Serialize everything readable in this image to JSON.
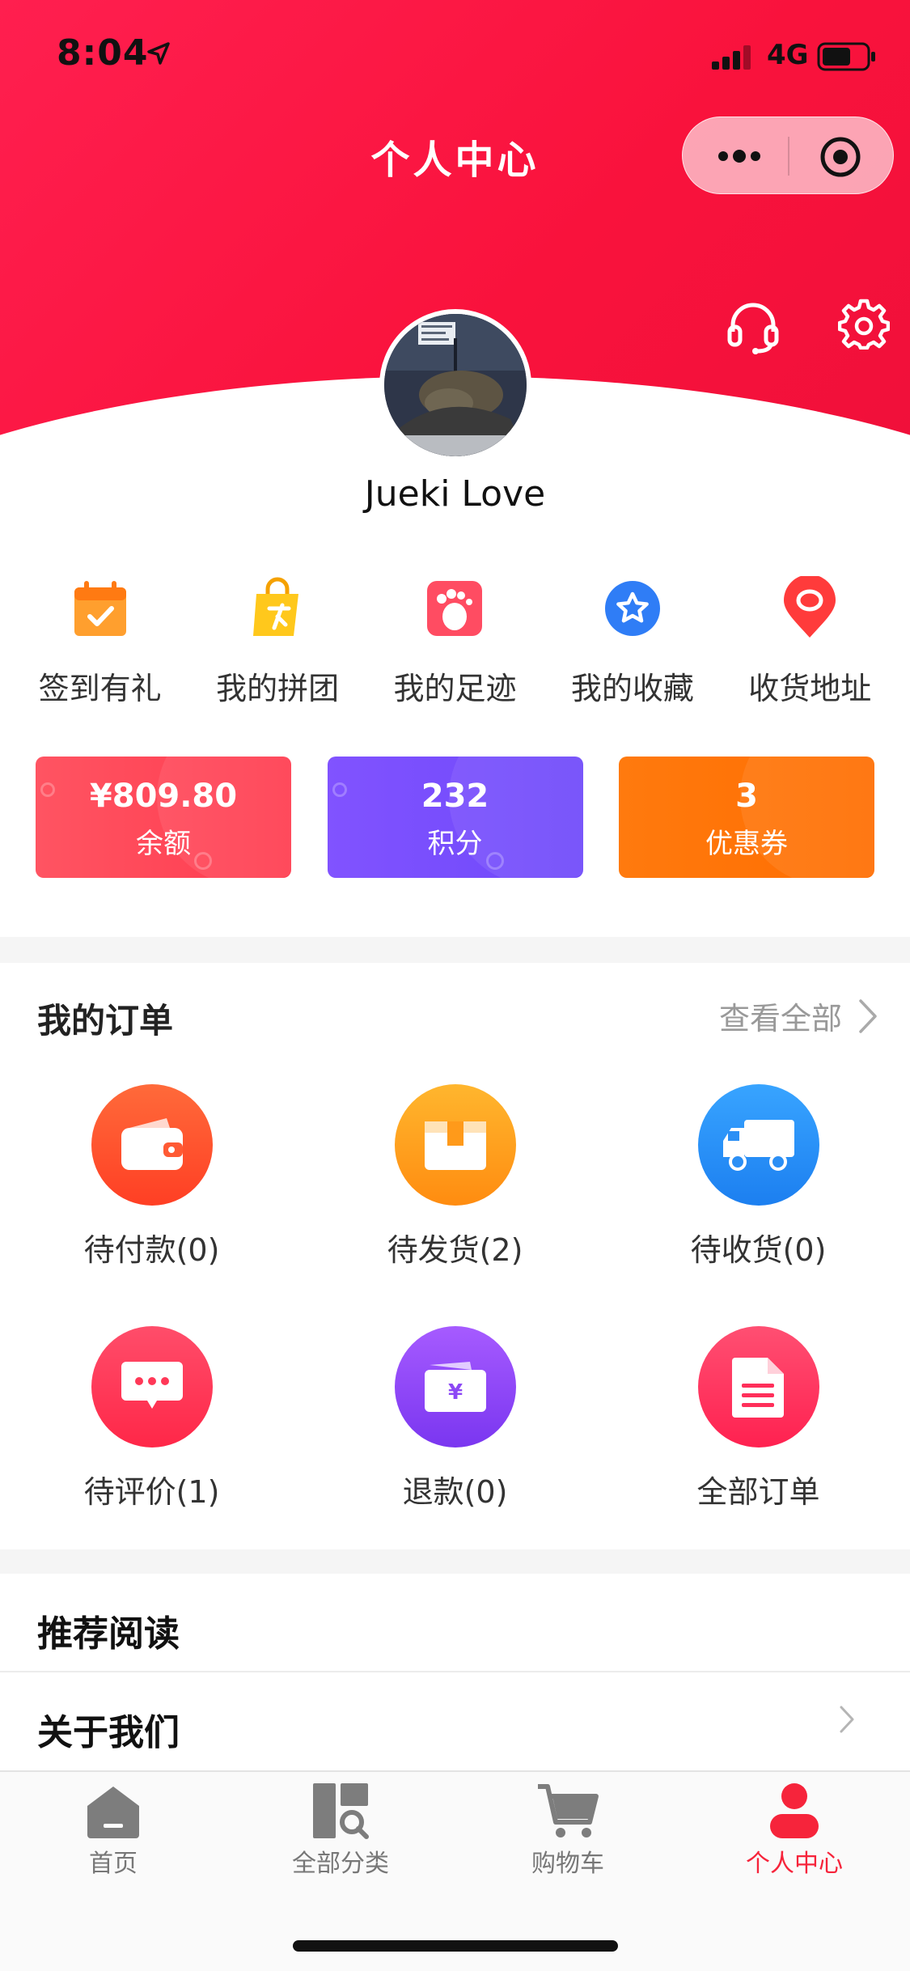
{
  "status_bar": {
    "time": "8:04",
    "network": "4G"
  },
  "nav": {
    "title": "个人中心"
  },
  "profile": {
    "username": "Jueki Love"
  },
  "quick_links": [
    {
      "label": "签到有礼",
      "icon": "calendar-check-icon",
      "color": "#ff8a1f"
    },
    {
      "label": "我的拼团",
      "icon": "shopping-bag-icon",
      "color": "#ffc61a"
    },
    {
      "label": "我的足迹",
      "icon": "footprint-icon",
      "color": "#ff4c60"
    },
    {
      "label": "我的收藏",
      "icon": "star-icon",
      "color": "#2f7df6"
    },
    {
      "label": "收货地址",
      "icon": "location-pin-icon",
      "color": "#ff3b3b"
    }
  ],
  "stats": [
    {
      "value": "¥809.80",
      "label": "余额",
      "color": "#ff4a59"
    },
    {
      "value": "232",
      "label": "积分",
      "color": "#7650fc"
    },
    {
      "value": "3",
      "label": "优惠券",
      "color": "#ff7508"
    }
  ],
  "orders": {
    "title": "我的订单",
    "view_all": "查看全部",
    "items": [
      {
        "label": "待付款(0)",
        "icon": "wallet-icon",
        "color": "#ff5230"
      },
      {
        "label": "待发货(2)",
        "icon": "package-icon",
        "color": "#ffa41c"
      },
      {
        "label": "待收货(0)",
        "icon": "truck-icon",
        "color": "#2b8ff5"
      },
      {
        "label": "待评价(1)",
        "icon": "comment-icon",
        "color": "#ff3857"
      },
      {
        "label": "退款(0)",
        "icon": "refund-icon",
        "color": "#8c48f5"
      },
      {
        "label": "全部订单",
        "icon": "document-icon",
        "color": "#ff2f5a"
      }
    ]
  },
  "menu": [
    {
      "label": "推荐阅读"
    },
    {
      "label": "关于我们"
    }
  ],
  "tabbar": [
    {
      "label": "首页",
      "icon": "home-icon",
      "active": false
    },
    {
      "label": "全部分类",
      "icon": "category-icon",
      "active": false
    },
    {
      "label": "购物车",
      "icon": "cart-icon",
      "active": false
    },
    {
      "label": "个人中心",
      "icon": "profile-icon",
      "active": true
    }
  ],
  "colors": {
    "primary": "#f81540",
    "active_tab": "#f6243b",
    "inactive_tab": "#8a8a8a"
  }
}
